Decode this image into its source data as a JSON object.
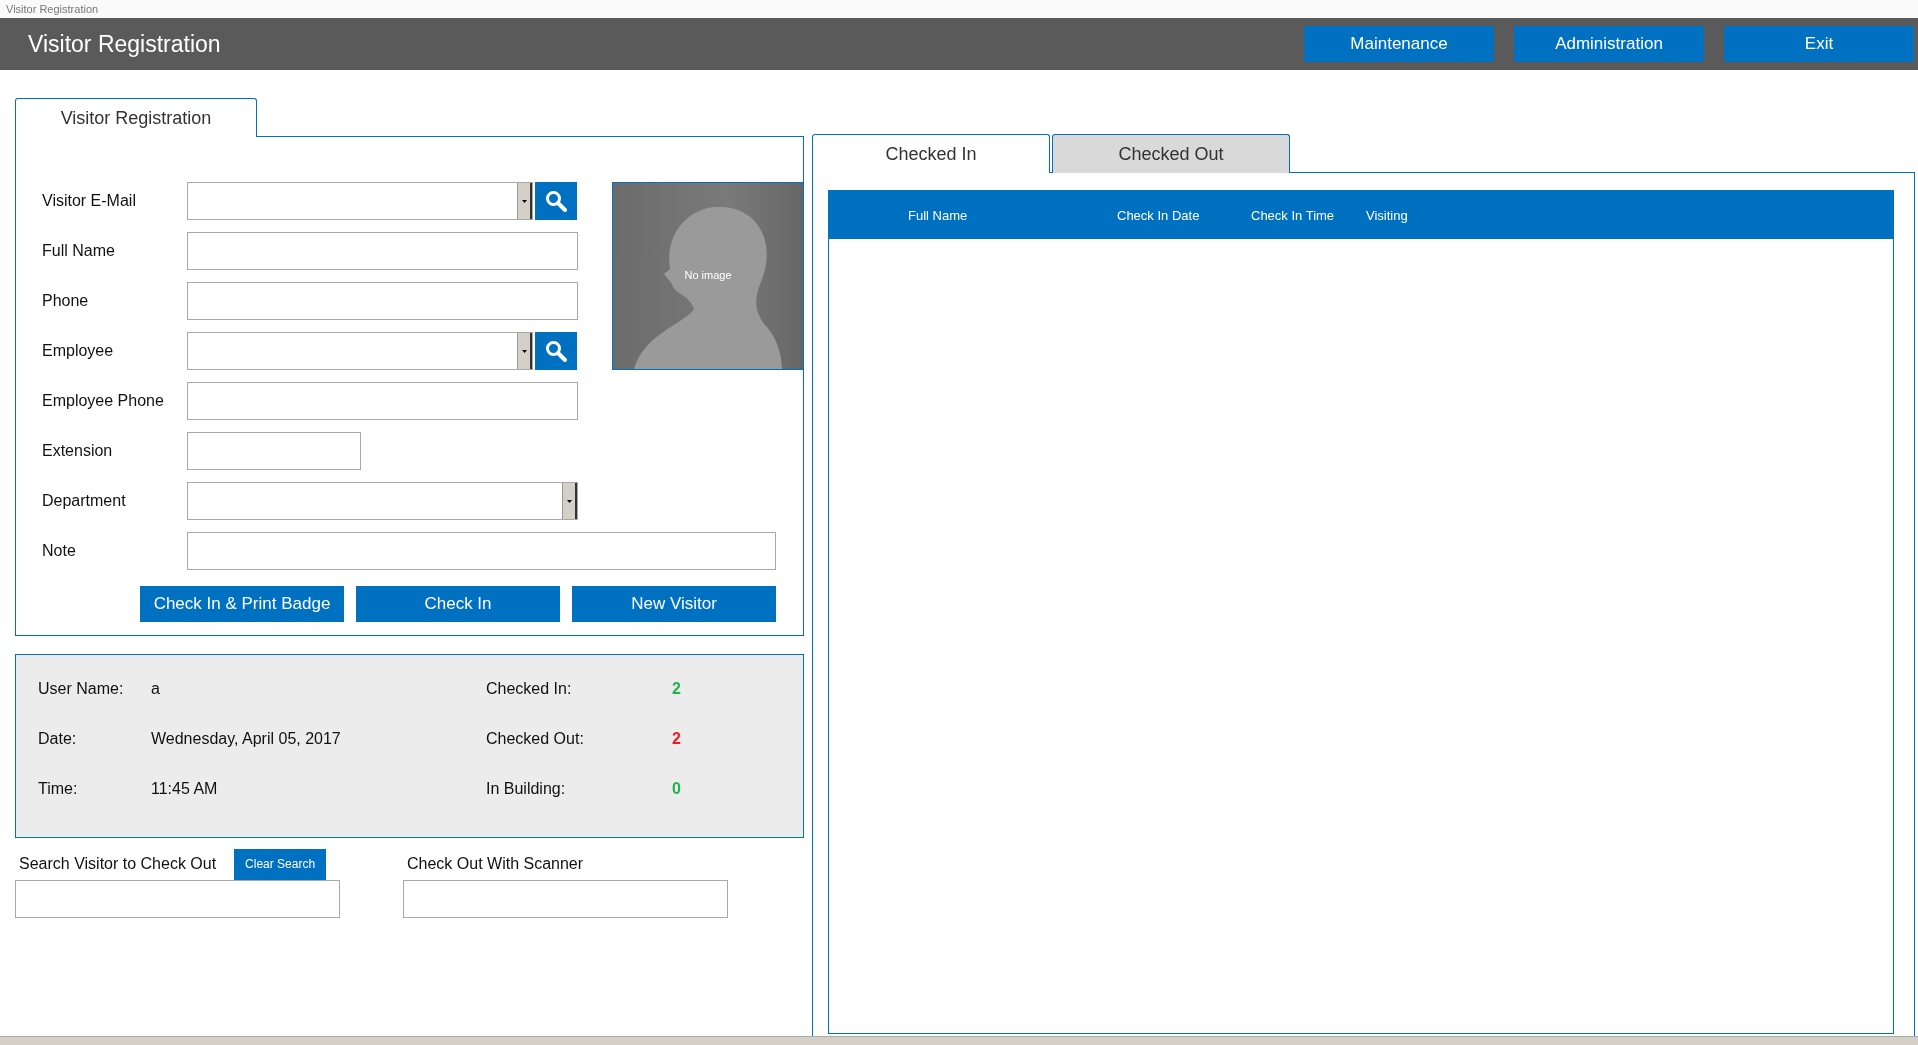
{
  "window": {
    "title": "Visitor Registration"
  },
  "header": {
    "title": "Visitor Registration",
    "buttons": [
      "Maintenance",
      "Administration",
      "Exit"
    ]
  },
  "form_tab": {
    "label": "Visitor Registration",
    "selected": true
  },
  "fields": [
    {
      "label": "Visitor E-Mail",
      "kind": "combo_search"
    },
    {
      "label": "Full Name",
      "kind": "text"
    },
    {
      "label": "Phone",
      "kind": "text"
    },
    {
      "label": "Employee",
      "kind": "combo_search"
    },
    {
      "label": "Employee Phone",
      "kind": "text"
    },
    {
      "label": "Extension",
      "kind": "short"
    },
    {
      "label": "Department",
      "kind": "combo"
    },
    {
      "label": "Note",
      "kind": "long"
    }
  ],
  "photo": {
    "caption": "No image"
  },
  "actions": [
    "Check In & Print Badge",
    "Check In",
    "New Visitor"
  ],
  "session": [
    {
      "label": "User Name:",
      "value": "a"
    },
    {
      "label": "Date:",
      "value": "Wednesday, April 05, 2017"
    },
    {
      "label": "Time:",
      "value": "11:45 AM"
    }
  ],
  "counts": [
    {
      "label": "Checked In:",
      "value": "2",
      "color": "#22b14c"
    },
    {
      "label": "Checked Out:",
      "value": "2",
      "color": "#ed1c24"
    },
    {
      "label": "In Building:",
      "value": "0",
      "color": "#22b14c"
    }
  ],
  "checkout": {
    "search_label": "Search Visitor to Check Out",
    "clear_button": "Clear Search",
    "scanner_label": "Check Out With Scanner"
  },
  "list_tabs": [
    {
      "label": "Checked In",
      "selected": true
    },
    {
      "label": "Checked Out",
      "selected": false
    }
  ],
  "table": {
    "columns": [
      "Full Name",
      "Check In Date",
      "Check In Time",
      "Visiting"
    ]
  }
}
